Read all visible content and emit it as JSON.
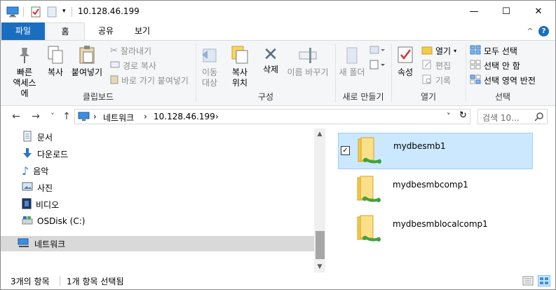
{
  "window": {
    "title": "10.128.46.199",
    "controls": {
      "minimize": "—",
      "maximize": "☐",
      "close": "✕"
    },
    "collapse_ribbon": "^",
    "help": "?"
  },
  "ribbon_tabs": [
    "파일",
    "홈",
    "공유",
    "보기"
  ],
  "ribbon": {
    "clipboard": {
      "label": "클립보드",
      "pin_quick": [
        "빠른",
        "액세스에"
      ],
      "copy": "복사",
      "paste": "붙여넣기",
      "cut": "잘라내기",
      "copy_path": "경로 복사",
      "paste_shortcut": "바로 가기 붙여넣기"
    },
    "organize": {
      "label": "구성",
      "move_to": [
        "이동",
        "대상"
      ],
      "copy_to": [
        "복사",
        "위치"
      ],
      "delete": "삭제",
      "rename": "이름 바꾸기"
    },
    "new": {
      "label": "새로 만들기",
      "new_folder": "새 폴더"
    },
    "open": {
      "label": "열기",
      "properties": "속성",
      "open": "열기",
      "edit": "편집",
      "history": "기록"
    },
    "select": {
      "label": "선택",
      "select_all": "모두 선택",
      "select_none": "선택 안 함",
      "invert": "선택 영역 반전"
    }
  },
  "address_bar": {
    "back": "←",
    "forward": "→",
    "history_dropdown": "˅",
    "up": "↑",
    "segments": [
      "네트워크",
      "10.128.46.199"
    ],
    "separator": "›",
    "dropdown": "˅",
    "refresh": "↻",
    "search_placeholder": "검색 10...",
    "search_icon": "search-icon"
  },
  "nav_pane": {
    "items": [
      {
        "label": "문서",
        "icon": "documents-icon"
      },
      {
        "label": "다운로드",
        "icon": "downloads-icon"
      },
      {
        "label": "음악",
        "icon": "music-icon"
      },
      {
        "label": "사진",
        "icon": "pictures-icon"
      },
      {
        "label": "비디오",
        "icon": "videos-icon"
      },
      {
        "label": "OSDisk (C:)",
        "icon": "drive-icon"
      }
    ],
    "selected": {
      "label": "네트워크",
      "icon": "network-icon"
    },
    "scroll_up": "▲",
    "scroll_down": "▼"
  },
  "files": [
    {
      "name": "mydbesmb1",
      "selected": true,
      "checked": "✓"
    },
    {
      "name": "mydbesmbcomp1",
      "selected": false
    },
    {
      "name": "mydbesmblocalcomp1",
      "selected": false
    }
  ],
  "status_bar": {
    "count": "3개의 항목",
    "selection": "1개 항목 선택됨"
  },
  "colors": {
    "file_tab": "#1a6ec0",
    "selected_item": "#cce8ff",
    "folder": "#f5c94a",
    "share_green": "#3fa33c"
  }
}
